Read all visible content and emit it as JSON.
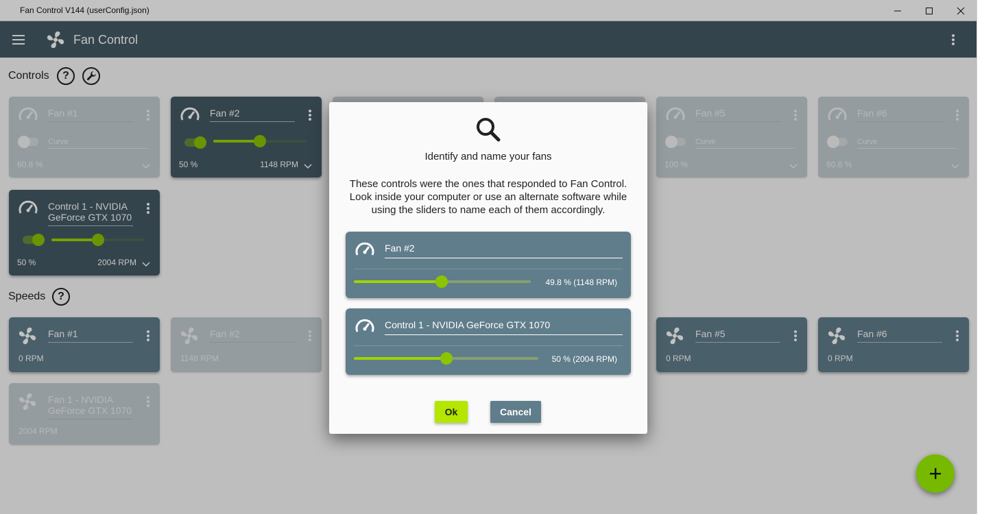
{
  "window": {
    "title": "Fan Control V144 (userConfig.json)"
  },
  "appbar": {
    "title": "Fan Control"
  },
  "sections": {
    "controls": "Controls",
    "speeds": "Speeds",
    "help_glyph": "?"
  },
  "controls": [
    {
      "name": "Fan #1",
      "enabled": false,
      "mode": "Curve",
      "percent": "60.8 %"
    },
    {
      "name": "Fan #2",
      "enabled": true,
      "percent": "50 %",
      "rpm": "1148 RPM",
      "slider_value": 0.5
    },
    {
      "name": "Fan #5",
      "enabled": false,
      "mode": "Curve",
      "percent": "100 %"
    },
    {
      "name": "Fan #6",
      "enabled": false,
      "mode": "Curve",
      "percent": "60.8 %"
    },
    {
      "name": "Control 1 - NVIDIA GeForce GTX 1070",
      "enabled": true,
      "percent": "50 %",
      "rpm": "2004 RPM",
      "slider_value": 0.5
    }
  ],
  "speeds": [
    {
      "name": "Fan #1",
      "value": "0 RPM"
    },
    {
      "name": "Fan #2",
      "value": "1148 RPM"
    },
    {
      "name": "Fan #5",
      "value": "0 RPM"
    },
    {
      "name": "Fan #6",
      "value": "0 RPM"
    },
    {
      "name": "Fan 1 - NVIDIA GeForce GTX 1070",
      "value": "2004 RPM"
    }
  ],
  "dialog": {
    "title": "Identify and name your fans",
    "description": "These controls were the ones that responded to Fan Control. Look inside your computer or use an alternate software while using the sliders to name each of them accordingly.",
    "fans": [
      {
        "name": "Fan #2",
        "value_text": "49.8 % (1148 RPM)",
        "slider_value": 0.498
      },
      {
        "name": "Control 1 - NVIDIA GeForce GTX 1070",
        "value_text": "50 % (2004 RPM)",
        "slider_value": 0.5
      }
    ],
    "ok_label": "Ok",
    "cancel_label": "Cancel"
  },
  "colors": {
    "accent": "#76b900",
    "appbar": "#455a64",
    "card": "#455a64",
    "dialog_card": "#607d8b"
  },
  "icons": {
    "menu": "hamburger-icon",
    "app": "fan-icon",
    "more": "more-vert-icon",
    "help": "help-icon",
    "settings": "wrench-icon",
    "search": "search-icon",
    "add": "plus-icon"
  }
}
